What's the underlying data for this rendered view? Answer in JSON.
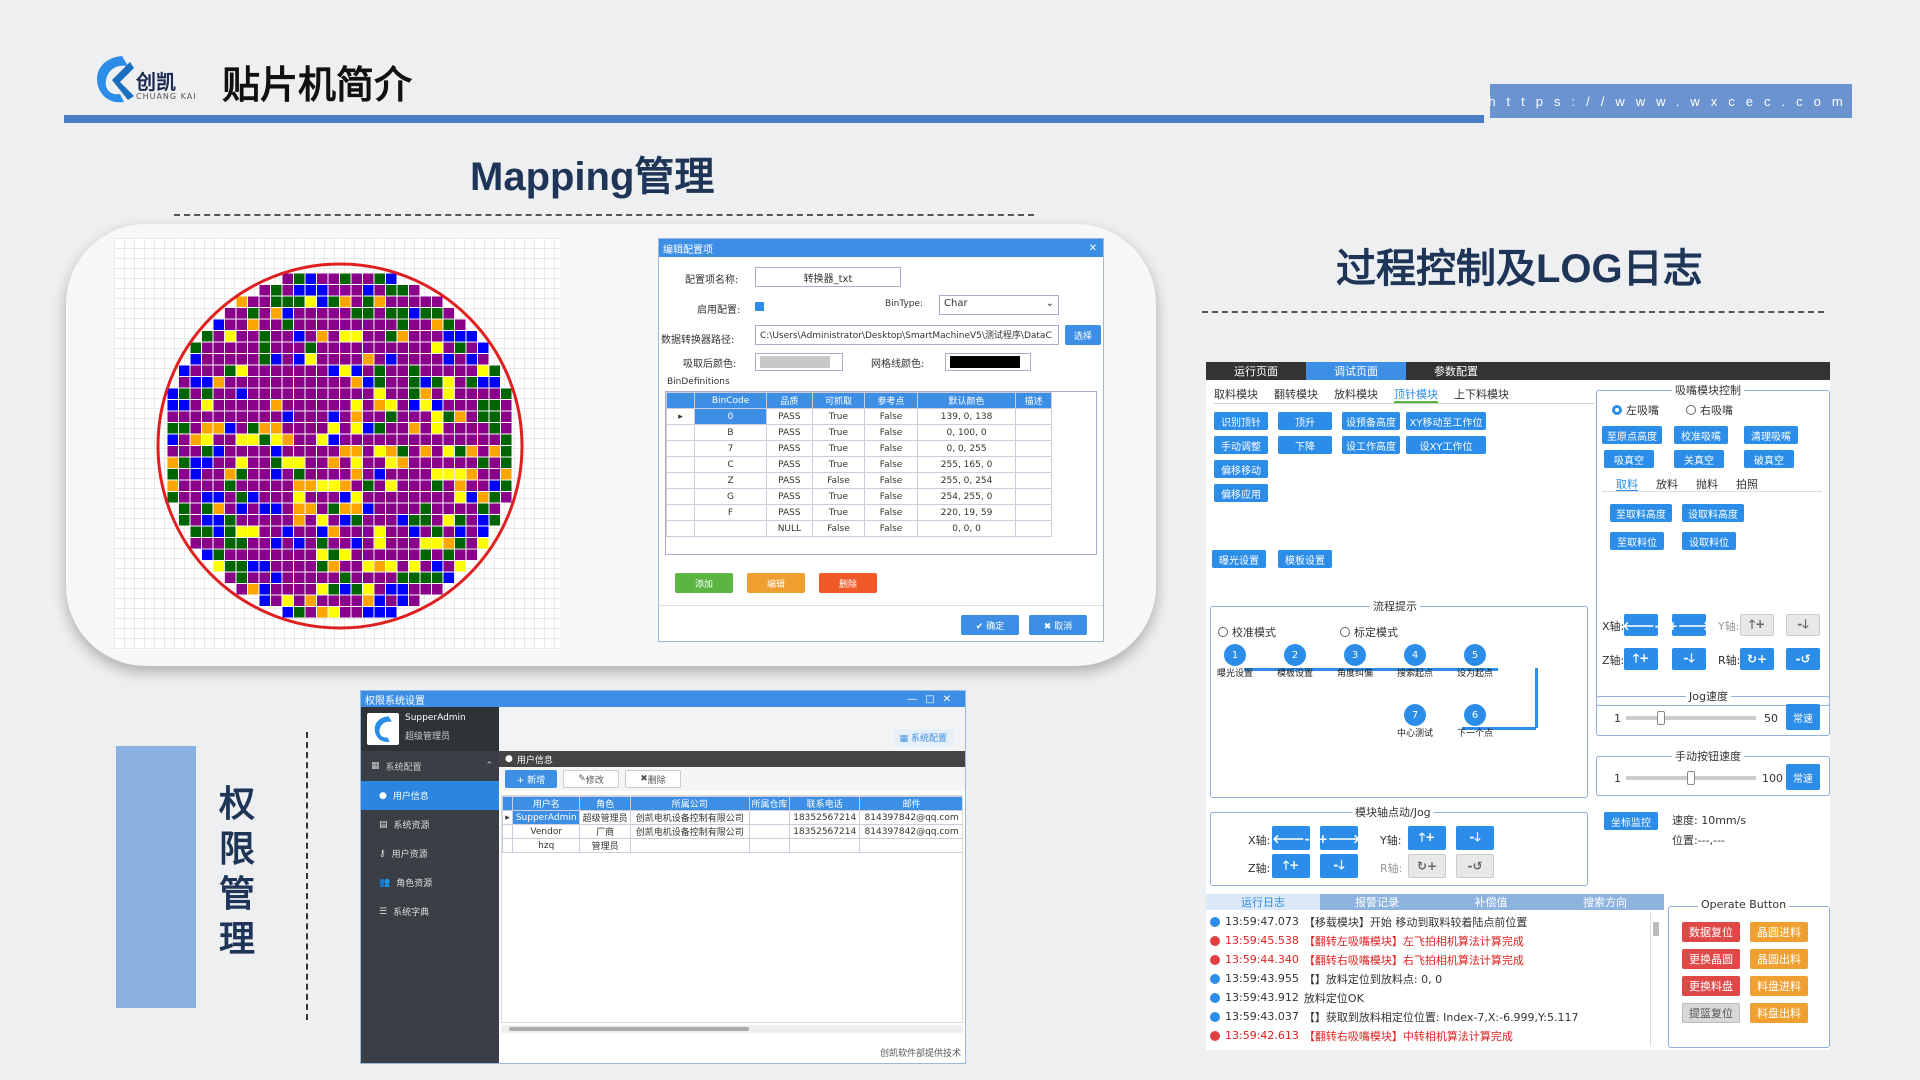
{
  "header": {
    "logo_text": "创凯",
    "logo_sub": "CHUANG KAI",
    "title": "贴片机简介",
    "url": "https://www.wxcec.com"
  },
  "mapping": {
    "section_title": "Mapping管理",
    "dialog": {
      "title": "编辑配置项",
      "config_name_label": "配置项名称:",
      "config_name_value": "转换器_txt",
      "enable_label": "启用配置:",
      "bintype_label": "BinType:",
      "bintype_value": "Char",
      "path_label": "数据转换器路径:",
      "path_value": "C:\\Users\\Administrator\\Desktop\\SmartMachineV5\\测试程序\\DataC",
      "select_btn": "选择",
      "after_color_label": "吸取后颜色:",
      "grid_color_label": "网格线颜色:",
      "bindef_label": "BinDefinitions",
      "columns": [
        "BinCode",
        "品质",
        "可抓取",
        "参考点",
        "默认颜色",
        "描述"
      ],
      "rows": [
        [
          "0",
          "PASS",
          "True",
          "False",
          "139, 0, 138",
          ""
        ],
        [
          "B",
          "PASS",
          "True",
          "False",
          "0, 100, 0",
          ""
        ],
        [
          "7",
          "PASS",
          "True",
          "False",
          "0, 0, 255",
          ""
        ],
        [
          "C",
          "PASS",
          "True",
          "False",
          "255, 165, 0",
          ""
        ],
        [
          "Z",
          "PASS",
          "False",
          "False",
          "255, 0, 254",
          ""
        ],
        [
          "G",
          "PASS",
          "True",
          "False",
          "254, 255, 0",
          ""
        ],
        [
          "F",
          "PASS",
          "True",
          "False",
          "220, 19, 59",
          ""
        ],
        [
          "",
          "NULL",
          "False",
          "False",
          "0, 0, 0",
          ""
        ]
      ],
      "add_btn": "添加",
      "edit_btn": "编辑",
      "delete_btn": "删除",
      "ok_btn": "✔ 确定",
      "cancel_btn": "✖ 取消"
    }
  },
  "permission": {
    "section_title": [
      "权",
      "限",
      "管",
      "理"
    ],
    "window_title": "权限系统设置",
    "user_name": "SupperAdmin",
    "user_role": "超级管理员",
    "system_config_tab": "系统配置",
    "menu_group": "系统配置",
    "menu": [
      "用户信息",
      "系统资源",
      "用户资源",
      "角色资源",
      "系统字典"
    ],
    "panel_title": "用户信息",
    "toolbar": [
      "+ 新增",
      "修改",
      "删除"
    ],
    "columns": [
      "用户名",
      "角色",
      "所属公司",
      "所属仓库",
      "联系电话",
      "邮件"
    ],
    "rows": [
      [
        "SupperAdmin",
        "超级管理员",
        "创凯电机设备控制有限公司",
        "",
        "18352567214",
        "814397842@qq.com"
      ],
      [
        "Vendor",
        "厂商",
        "创凯电机设备控制有限公司",
        "",
        "18352567214",
        "814397842@qq.com"
      ],
      [
        "hzq",
        "管理员",
        "",
        "",
        "",
        ""
      ]
    ],
    "footer": "创凯软件部提供技术"
  },
  "process": {
    "section_title": "过程控制及LOG日志",
    "top_tabs": [
      "运行页面",
      "调试页面",
      "参数配置"
    ],
    "sub_tabs": [
      "取料模块",
      "翻转模块",
      "放料模块",
      "顶针模块",
      "上下料模块"
    ],
    "ejector_buttons": [
      "识别顶针",
      "顶升",
      "设预备高度",
      "XY移动至工作位",
      "手动调整",
      "下降",
      "设工作高度",
      "设XY工作位",
      "偏移移动",
      "偏移应用"
    ],
    "light_btn": "曝光设置",
    "template_btn": "模板设置",
    "nozzle": {
      "title": "吸嘴模块控制",
      "left": "左吸嘴",
      "right": "右吸嘴",
      "buttons": [
        "至原点高度",
        "校准吸嘴",
        "清理吸嘴",
        "吸真空",
        "关真空",
        "破真空"
      ],
      "tabs": [
        "取料",
        "放料",
        "抛料",
        "拍照"
      ],
      "pick_buttons": [
        "至取料高度",
        "设取料高度",
        "至取料位",
        "设取料位"
      ],
      "axis_labels": [
        "X轴:",
        "Y轴:",
        "Z轴:",
        "R轴:"
      ]
    },
    "flow": {
      "title": "流程提示",
      "mode1": "校准模式",
      "mode2": "标定模式",
      "nodes": [
        {
          "n": "1",
          "label": "曝光设置"
        },
        {
          "n": "2",
          "label": "模板设置"
        },
        {
          "n": "3",
          "label": "角度纠偏"
        },
        {
          "n": "4",
          "label": "搜索起点"
        },
        {
          "n": "5",
          "label": "设为起点"
        },
        {
          "n": "6",
          "label": "下一个点"
        },
        {
          "n": "7",
          "label": "中心测试"
        }
      ]
    },
    "jog_speed": {
      "title": "Jog速度",
      "min": "1",
      "max": "50",
      "btn": "常速",
      "level": 0.25
    },
    "hand_speed": {
      "title": "手动按钮速度",
      "min": "1",
      "max": "100",
      "btn": "常速",
      "level": 0.5
    },
    "module_jog": {
      "title": "模块轴点动/Jog",
      "x": "X轴:",
      "y": "Y轴:",
      "z": "Z轴:",
      "r": "R轴:"
    },
    "coord": {
      "btn": "坐标监控",
      "speed": "速度: 10mm/s",
      "position": "位置:---,---"
    },
    "log_tabs": [
      "运行日志",
      "报警记录",
      "补偿值",
      "搜索方向"
    ],
    "logs": [
      {
        "type": "info",
        "time": "13:59:47.073",
        "text": "【移载模块】开始 移动到取料较着陆点前位置"
      },
      {
        "type": "err",
        "time": "13:59:45.538",
        "text": "【翻转左吸嘴模块】左飞拍相机算法计算完成"
      },
      {
        "type": "err",
        "time": "13:59:44.340",
        "text": "【翻转右吸嘴模块】右飞拍相机算法计算完成"
      },
      {
        "type": "info",
        "time": "13:59:43.955",
        "text": "【】放料定位到放料点: 0, 0"
      },
      {
        "type": "info",
        "time": "13:59:43.912",
        "text": "放料定位OK"
      },
      {
        "type": "info",
        "time": "13:59:43.037",
        "text": "【】获取到放料相定位位置: Index-7,X:-6.999,Y:5.117"
      },
      {
        "type": "err",
        "time": "13:59:42.613",
        "text": "【翻转右吸嘴模块】中转相机算法计算完成"
      }
    ],
    "operate": {
      "title": "Operate Button",
      "buttons": [
        {
          "label": "数据复位",
          "color": "#e04848"
        },
        {
          "label": "晶圆进料",
          "color": "#f0a030"
        },
        {
          "label": "更换晶圆",
          "color": "#e04848"
        },
        {
          "label": "晶圆出料",
          "color": "#f0a030"
        },
        {
          "label": "更换料盘",
          "color": "#e04848"
        },
        {
          "label": "料盘进料",
          "color": "#f0a030"
        },
        {
          "label": "提篮复位",
          "color": "#d8d8d8"
        },
        {
          "label": "料盘出料",
          "color": "#f0a030"
        }
      ]
    }
  }
}
